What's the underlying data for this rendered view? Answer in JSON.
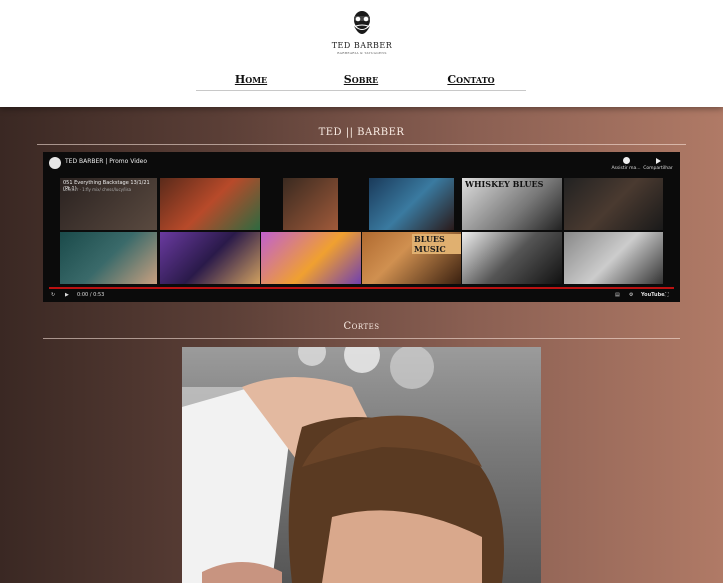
{
  "header": {
    "logo_text": "TED BARBER",
    "logo_sub": "BARBEARIA & TATUAGENS",
    "nav": [
      "Home",
      "Sobre",
      "Contato"
    ]
  },
  "video_section": {
    "title": "TED || BARBER",
    "video_title": "TED BARBER | Promo Video",
    "watch_later": "Assistir ma...",
    "share": "Compartilhar",
    "current_title": "051 Everything Backstage 13/1/21 (Pt.1)",
    "current_sub": "Lofi/a.fr · 1:fly mix/ chess/lucy/lisa",
    "time": "0:00 / 0:53",
    "youtube_label": "YouTube",
    "thumb_labels": [
      "WHISKEY BLUES",
      "BLUES MUSIC"
    ]
  },
  "cortes_section": {
    "title": "Cortes"
  },
  "colors": {
    "bg_left": "#3a2823",
    "bg_right": "#b07a66",
    "progress": "#bb1111"
  }
}
